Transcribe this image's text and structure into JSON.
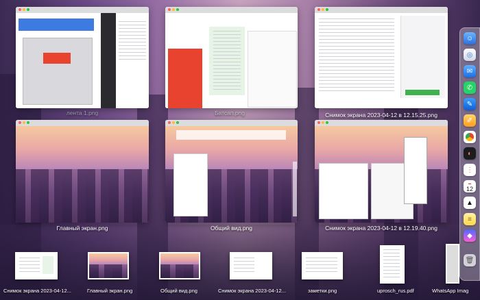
{
  "windows": [
    {
      "label": "Снимок экрана 2023-04-12 в 12.15.25.png"
    },
    {
      "label": "Главный экран.png"
    },
    {
      "label": "Общий вид.png"
    },
    {
      "label": "Снимок экрана 2023-04-12 в 12.19.40.png"
    }
  ],
  "partial_labels": {
    "top_left": "лента 1.png",
    "top_center": "Батсап.png"
  },
  "shelf": [
    {
      "label": "Снимок экрана 2023-04-12..."
    },
    {
      "label": "Главный экран.png"
    },
    {
      "label": "Общий вид.png"
    },
    {
      "label": "Снимок экрана 2023-04-12..."
    },
    {
      "label": "заметки.png"
    },
    {
      "label": "uprosch_rus.pdf"
    },
    {
      "label": "WhatsApp Imag"
    }
  ],
  "dock": {
    "calendar_day": "12"
  },
  "colors": {
    "accent_red": "#e8432e",
    "whatsapp_green": "#25d366"
  }
}
